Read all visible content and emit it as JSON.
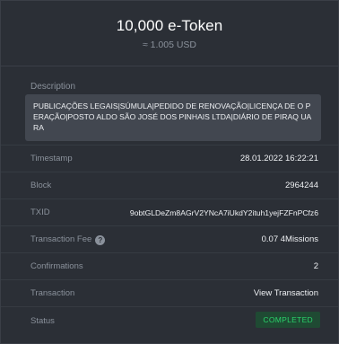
{
  "header": {
    "amount": "10,000 e-Token",
    "fiat": "≈ 1.005 USD"
  },
  "description": {
    "label": "Description",
    "text": "PUBLICAÇÕES LEGAIS|SÚMULA|PEDIDO DE RENOVAÇÃO|LICENÇA DE O PERAÇÃO|POSTO ALDO SÃO JOSÉ DOS PINHAIS LTDA|DIÁRIO DE PIRAQ UARA"
  },
  "fields": {
    "timestamp": {
      "label": "Timestamp",
      "value": "28.01.2022 16:22:21"
    },
    "block": {
      "label": "Block",
      "value": "2964244"
    },
    "txid": {
      "label": "TXID",
      "value": "9obtGLDeZm8AGrV2YNcA7iUkdY2ituh1yejFZFnPCfz6"
    },
    "fee": {
      "label": "Transaction Fee",
      "value": "0.07 4Missions",
      "icon": "question-circle-icon"
    },
    "confirmations": {
      "label": "Confirmations",
      "value": "2"
    },
    "transaction": {
      "label": "Transaction",
      "link": "View Transaction"
    },
    "status": {
      "label": "Status",
      "badge": "COMPLETED"
    }
  },
  "colors": {
    "background": "#2b2f36",
    "link": "#4f8ff7",
    "status_badge_text": "#2bd26b",
    "status_badge_bg": "#1f4a33"
  }
}
